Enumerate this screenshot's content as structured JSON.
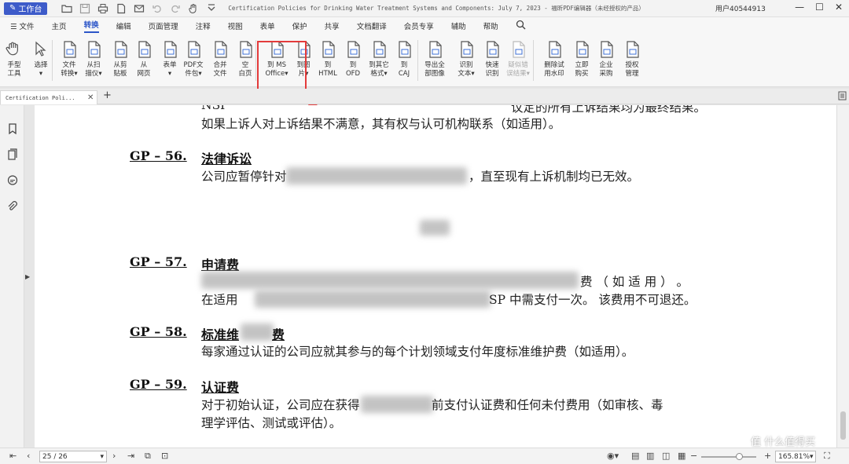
{
  "titlebar": {
    "workbench": "工作台",
    "doc_title": "Certification Policies for Drinking Water Treatment Systems and Components: July 7, 2023 - 福昕PDF编辑器（未经授权的产品）",
    "user": "用户40544913",
    "win_min": "—",
    "win_max": "☐",
    "win_close": "✕"
  },
  "menu": {
    "file": "☰ 文件",
    "items": [
      "主页",
      "转换",
      "编辑",
      "页面管理",
      "注释",
      "视图",
      "表单",
      "保护",
      "共享",
      "文档翻译",
      "会员专享",
      "辅助",
      "帮助"
    ]
  },
  "ribbon": {
    "tools": [
      {
        "label": "手型\n工具",
        "icon": "hand-icon"
      },
      {
        "label": "选择\n▾",
        "icon": "cursor-icon"
      },
      {
        "label": "文件\n转换▾",
        "icon": "file-convert-icon"
      },
      {
        "label": "从扫\n描仪▾",
        "icon": "scanner-icon"
      },
      {
        "label": "从剪\n贴板",
        "icon": "clipboard-icon"
      },
      {
        "label": "从\n网页",
        "icon": "webpage-icon"
      },
      {
        "label": "表单\n▾",
        "icon": "form-icon"
      },
      {
        "label": "PDF文\n件包▾",
        "icon": "pdf-package-icon"
      },
      {
        "label": "合并\n文件",
        "icon": "merge-icon"
      },
      {
        "label": "空\n白页",
        "icon": "blank-page-icon"
      },
      {
        "label": "到 MS\nOffice▾",
        "icon": "to-office-icon"
      },
      {
        "label": "到图\n片▾",
        "icon": "to-image-icon"
      },
      {
        "label": "到\nHTML",
        "icon": "to-html-icon"
      },
      {
        "label": "到\nOFD",
        "icon": "to-ofd-icon"
      },
      {
        "label": "到其它\n格式▾",
        "icon": "to-other-icon"
      },
      {
        "label": "到\nCAJ",
        "icon": "to-caj-icon"
      },
      {
        "label": "导出全\n部图像",
        "icon": "export-images-icon"
      },
      {
        "label": "识别\n文本▾",
        "icon": "ocr-icon"
      },
      {
        "label": "快速\n识别",
        "icon": "quick-ocr-icon"
      },
      {
        "label": "疑似错\n误结果▾",
        "icon": "suspect-icon"
      },
      {
        "label": "删除试\n用水印",
        "icon": "remove-watermark-icon"
      },
      {
        "label": "立即\n购买",
        "icon": "cart-icon"
      },
      {
        "label": "企业\n采购",
        "icon": "enterprise-icon"
      },
      {
        "label": "授权\n管理",
        "icon": "license-icon"
      }
    ]
  },
  "tabs": {
    "doc_tab": "Certification Poli...",
    "close": "✕",
    "add": "+"
  },
  "document": {
    "l0": "NSI",
    "l0b": "议定的所有上诉结果均为最终结果。",
    "l1": "如果上诉人对上诉结果不满意，其有权与认可机构联系（如适用）。",
    "gp56": "GP – 56.",
    "gp56_title": "法律诉讼",
    "l56a": "公司应暂停针对",
    "l56b": "，直至现有上诉机制均已无效。",
    "gp57": "GP – 57.",
    "gp57_title": "申请费",
    "l57a": "费 （ 如 适 用 ） 。",
    "l57b": "在适用",
    "l57c": "SP 中需支付一次。 该费用不可退还。",
    "gp58": "GP – 58.",
    "gp58_title": "标准维",
    "gp58_tail": "费",
    "l58": "每家通过认证的公司应就其参与的每个计划领域支付年度标准维护费（如适用）。",
    "gp59": "GP – 59.",
    "gp59_title": "认证费",
    "l59a": "对于初始认证，公司应在获得",
    "l59b": "前支付认证费和任何未付费用（如审核、毒",
    "l59c": "理学评估、测试或评估）。"
  },
  "status": {
    "page": "25 / 26",
    "zoom": "165.81%"
  },
  "watermark": "值 什么值得买"
}
